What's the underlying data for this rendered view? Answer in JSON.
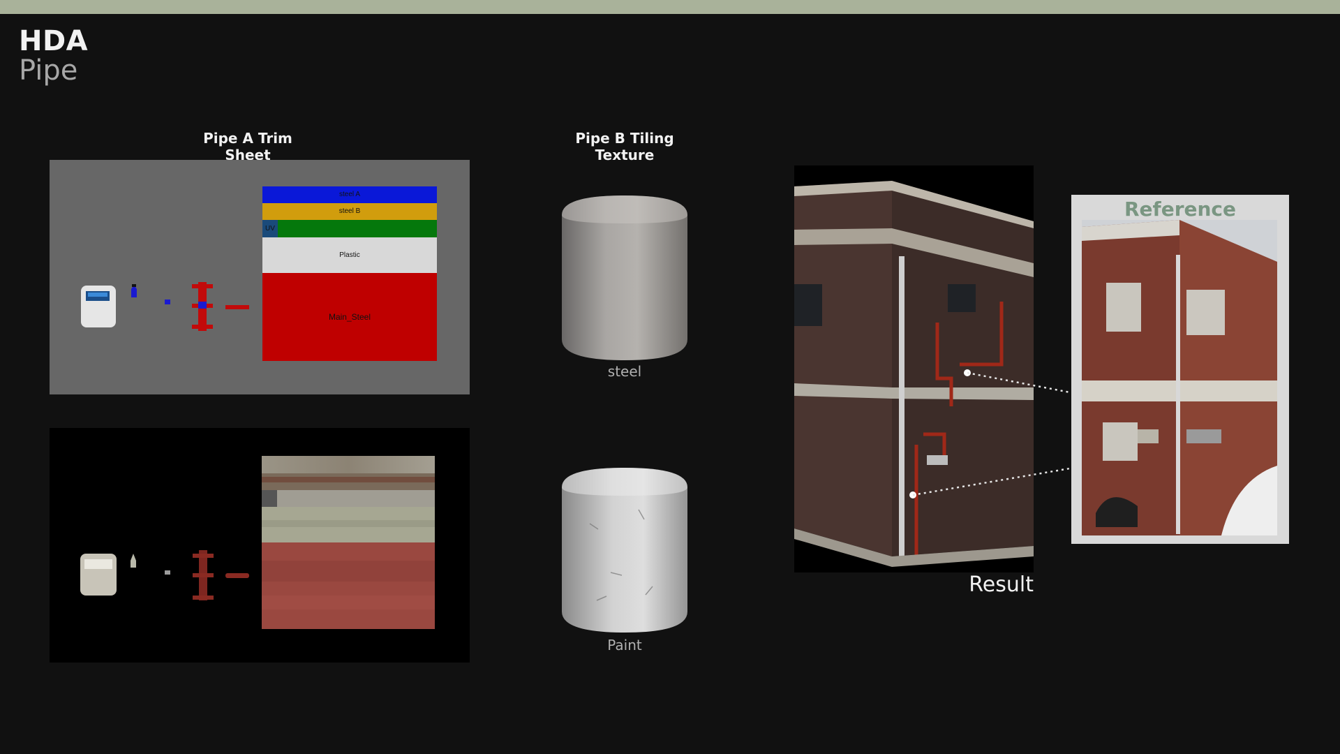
{
  "header": {
    "title": "HDA",
    "subtitle": "Pipe"
  },
  "sections": {
    "trim_title": "Pipe A Trim Sheet",
    "tiling_title": "Pipe B Tiling Texture"
  },
  "atlas_labels": {
    "steel_a": "steel A",
    "steel_b": "steel B",
    "uv": "UV",
    "plastic": "Plastic",
    "main_steel": "Main_Steel"
  },
  "swatches": {
    "steel": "steel",
    "paint": "Paint"
  },
  "result": {
    "label": "Result"
  },
  "reference": {
    "title": "Reference"
  },
  "colors": {
    "background": "#111111",
    "topbar": "#a9b29a",
    "atlas_blue": "#0a18d8",
    "atlas_gold": "#d19d0d",
    "atlas_green": "#05780c",
    "atlas_plastic": "#d8d8d8",
    "atlas_red": "#bf0000",
    "reference_accent": "#7a9682"
  }
}
